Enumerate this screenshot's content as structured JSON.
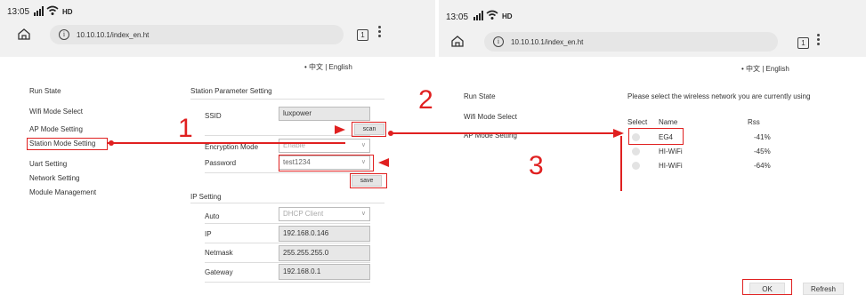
{
  "left_screen": {
    "status": {
      "time": "13:05",
      "network": "HD"
    },
    "browser": {
      "url": "10.10.10.1/index_en.ht",
      "tab_count": "1"
    },
    "language": "• 中文 | English",
    "menu": [
      "Run State",
      "Wifi Mode Select",
      "AP Mode Setting",
      "Station Mode Setting",
      "Uart Setting",
      "Network Setting",
      "Module Management"
    ],
    "station_section_title": "Station Parameter Setting",
    "ssid_label": "SSID",
    "ssid_value": "luxpower",
    "scan_label": "scan",
    "encryption_label": "Encryption Mode",
    "encryption_value": "Enable",
    "password_label": "Password",
    "password_value": "test1234",
    "save_label": "save",
    "ip_section_title": "IP Setting",
    "auto_label": "Auto",
    "auto_value": "DHCP Client",
    "ip_label": "IP",
    "ip_value": "192.168.0.146",
    "netmask_label": "Netmask",
    "netmask_value": "255.255.255.0",
    "gateway_label": "Gateway",
    "gateway_value": "192.168.0.1"
  },
  "right_screen": {
    "status": {
      "time": "13:05",
      "network": "HD"
    },
    "browser": {
      "url": "10.10.10.1/index_en.ht",
      "tab_count": "1"
    },
    "language": "• 中文 | English",
    "menu": [
      "Run State",
      "Wifi Mode Select",
      "AP Mode Setting"
    ],
    "instruction": "Please select the wireless network you are currently using",
    "table_headers": [
      "Select",
      "Name",
      "Rss"
    ],
    "networks": [
      {
        "name": "EG4",
        "rss": "-41%"
      },
      {
        "name": "HI-WiFi",
        "rss": "-45%"
      },
      {
        "name": "HI-WiFi",
        "rss": "-64%"
      }
    ],
    "ok_label": "OK",
    "refresh_label": "Refresh"
  },
  "annotations": {
    "step1": "1",
    "step2": "2",
    "step3": "3"
  },
  "colors": {
    "annotation": "#e02020",
    "topbar": "#f1f1f1",
    "field_gray": "#e7e7e7"
  }
}
